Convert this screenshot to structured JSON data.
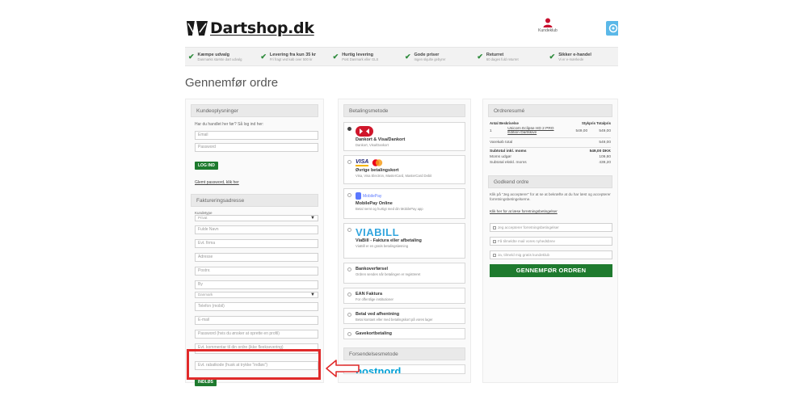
{
  "header": {
    "logo_text": "Dartshop.dk",
    "account_label": "Kundeklub",
    "usps": [
      {
        "title": "Kæmpe udvalg",
        "sub": "Danmarks største dart udvalg"
      },
      {
        "title": "Levering fra kun 35 kr",
        "sub": "Fri fragt ved køb over 500 kr"
      },
      {
        "title": "Hurtig levering",
        "sub": "Post Danmark eller GLS"
      },
      {
        "title": "Gode priser",
        "sub": "Ingen skjulte gebyrer"
      },
      {
        "title": "Returret",
        "sub": "60 dages fuld returret"
      },
      {
        "title": "Sikker e-handel",
        "sub": "Vi er e-mærkede"
      }
    ]
  },
  "page_title": "Gennemfør ordre",
  "customer": {
    "heading": "Kundeoplysninger",
    "prompt": "Har du handlet her før? Så log ind her:",
    "email_placeholder": "Email",
    "password_placeholder": "Password",
    "login_label": "LOG IND",
    "forgot_label": "Glemt password, klik her"
  },
  "billing": {
    "heading": "Faktureringsadresse",
    "customer_type_label": "Kundetype",
    "customer_type_value": "Privat",
    "fields": [
      "Fulde Navn",
      "Evt. firma",
      "Adresse",
      "Postnr.",
      "By"
    ],
    "country_value": "Danmark",
    "fields2": [
      "Telefon (mobil)",
      "E-mail",
      "Password (hvis du ønsker at oprette en profil)",
      "Evt. kommentar til din ordre (ikke fleeksevering)"
    ],
    "coupon_placeholder": "Evt. rabatkode (husk at trykke \"indløs\")",
    "coupon_button": "INDLØS"
  },
  "payment": {
    "heading": "Betalingsmetode",
    "options": [
      {
        "title": "Dankort & Visa/Dankort",
        "desc": "Dankort, Visa/Dankort"
      },
      {
        "title": "Øvrige betalingskort",
        "desc": "Visa, Visa Electron, MasterCard, MasterCard Debit"
      },
      {
        "title": "MobilePay Online",
        "desc": "Betal nemt og hurtigt med din MobilePay app"
      },
      {
        "title": "ViaBill - Faktura eller afbetaling",
        "desc": "ViaBill er en gratis betalingsløsning"
      },
      {
        "title": "Bankoverførsel",
        "desc": "Ordren sendes når betalingen er registreret"
      },
      {
        "title": "EAN Faktura",
        "desc": "For offentlige institutioner"
      },
      {
        "title": "Betal ved afhentning",
        "desc": "Betal kontant eller med betalingskort på vores lager"
      },
      {
        "title": "Gavekortbetaling",
        "desc": ""
      }
    ],
    "mobilepay_logo": "MobilePay",
    "viabill_logo": "VIABILL",
    "visa_logo": "VISA"
  },
  "shipping": {
    "heading": "Forsendelsesmetode",
    "logo": "postnord"
  },
  "summary": {
    "heading": "Ordreresumé",
    "col_qty": "Antal",
    "col_desc": "Beskrivelse",
    "col_unit": "Stykpris",
    "col_total": "Totalpris",
    "item_qty": "1",
    "item_name": "Unicorn Eclipse HD 2 PRO Edition Dartskive",
    "item_unit": "549,00",
    "item_total": "549,00",
    "cart_total_label": "Varekøb total",
    "cart_total": "549,00",
    "subtotal_label": "Subtotal inkl. moms",
    "subtotal": "549,00 DKK",
    "vat_label": "Moms udgør",
    "vat": "109,80",
    "ex_vat_label": "Subtotal ekskl. moms",
    "ex_vat": "439,20"
  },
  "approve": {
    "heading": "Godkend ordre",
    "text": "Klik på \"Jeg accepterer\" for at se at bekræfte at du har læst og accepterer forretningsbetingelserne.",
    "terms_link": "Klik her for at læse forretningsbetingelser",
    "check1": "Jeg accepterer forretningsbetingelser",
    "check2": "Få tilmeldte mail vores nyhedsbrev",
    "check3": "Ja, tilmeld mig gratis kundeklub",
    "cta": "GENNEMFØR ORDREN"
  },
  "colors": {
    "highlight": "#e02a2a",
    "cta_green": "#1e7a2e",
    "dankort_red": "#d0162b",
    "viabill_blue": "#34a6de",
    "postnord_blue": "#00a0d6"
  }
}
